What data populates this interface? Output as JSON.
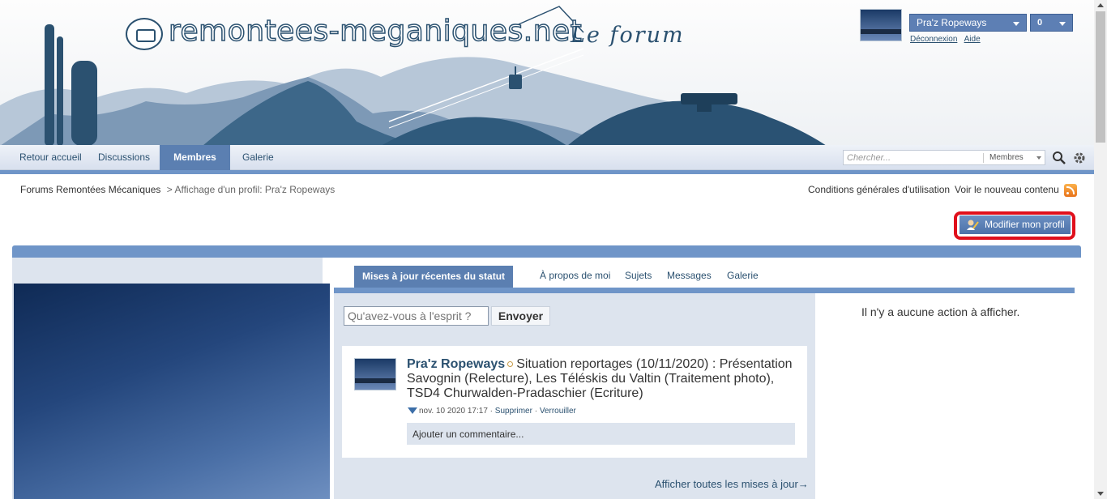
{
  "header": {
    "logo_text": "remontees-meganiques.net",
    "logo_sub": "Le forum"
  },
  "user": {
    "name": "Pra'z Ropeways",
    "notifications": "0",
    "logout": "Déconnexion",
    "help": "Aide"
  },
  "nav": {
    "items": [
      "Retour accueil",
      "Discussions",
      "Membres",
      "Galerie"
    ],
    "active": "Membres",
    "search_placeholder": "Chercher...",
    "search_scope": "Membres"
  },
  "breadcrumb": {
    "root": "Forums Remontées Mécaniques",
    "current": "> Affichage d'un profil: Pra'z Ropeways"
  },
  "top_links": {
    "terms": "Conditions générales d'utilisation",
    "new_content": "Voir le nouveau contenu"
  },
  "edit_profile": "Modifier mon profil",
  "tabs": [
    "Mises à jour récentes du statut",
    "À propos de moi",
    "Sujets",
    "Messages",
    "Galerie"
  ],
  "status": {
    "input_placeholder": "Qu'avez-vous à l'esprit ?",
    "send": "Envoyer",
    "post": {
      "author": "Pra'z Ropeways",
      "text": "Situation reportages (10/11/2020) : Présentation Savognin (Relecture), Les Téléskis du Valtin (Traitement photo), TSD4 Churwalden-Pradaschier (Ecriture)",
      "date": "nov. 10 2020 17:17",
      "delete": "Supprimer",
      "lock": "Verrouiller",
      "comment_placeholder": "Ajouter un commentaire..."
    },
    "show_all": "Afficher toutes les mises à jour→"
  },
  "no_action": "Il n'y a aucune action à afficher.",
  "colors": {
    "accent": "#5b7fb1",
    "dark_blue": "#2b5170",
    "highlight": "#e0101c"
  }
}
